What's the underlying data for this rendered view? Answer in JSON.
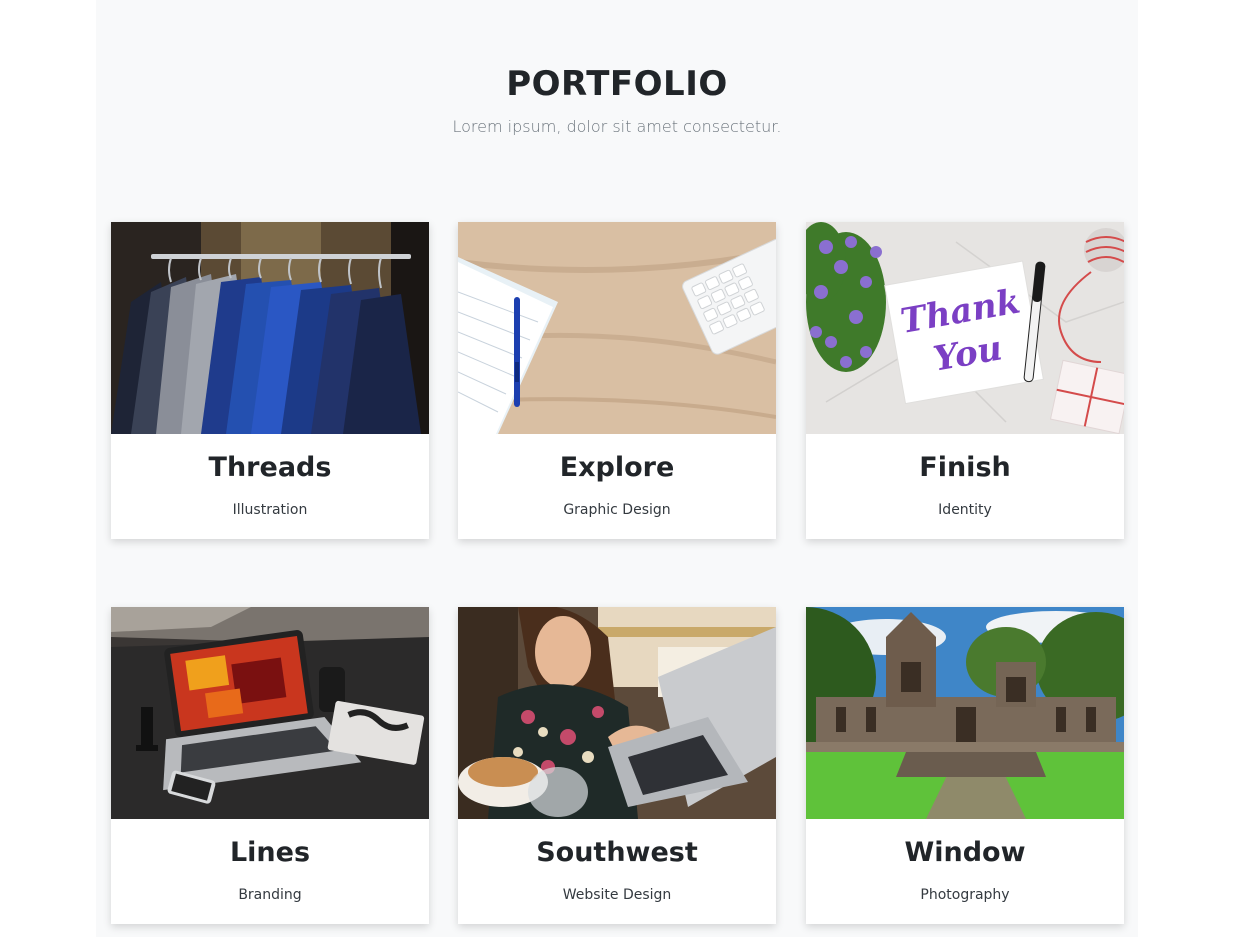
{
  "section": {
    "heading": "PORTFOLIO",
    "subheading": "Lorem ipsum, dolor sit amet consectetur."
  },
  "items": [
    {
      "title": "Threads",
      "category": "Illustration",
      "image": "clothes-rack-image"
    },
    {
      "title": "Explore",
      "category": "Graphic Design",
      "image": "desk-notebook-image"
    },
    {
      "title": "Finish",
      "category": "Identity",
      "image": "thank-you-card-image"
    },
    {
      "title": "Lines",
      "category": "Branding",
      "image": "laptop-desk-image"
    },
    {
      "title": "Southwest",
      "category": "Website Design",
      "image": "woman-laptop-image"
    },
    {
      "title": "Window",
      "category": "Photography",
      "image": "temple-ruins-image"
    }
  ],
  "image_text": {
    "thank_you_line1": "Thank",
    "thank_you_line2": "You"
  },
  "colors": {
    "section_bg": "#f8f9fa",
    "card_bg": "#ffffff",
    "heading": "#212529",
    "subheading": "#6c757d"
  }
}
